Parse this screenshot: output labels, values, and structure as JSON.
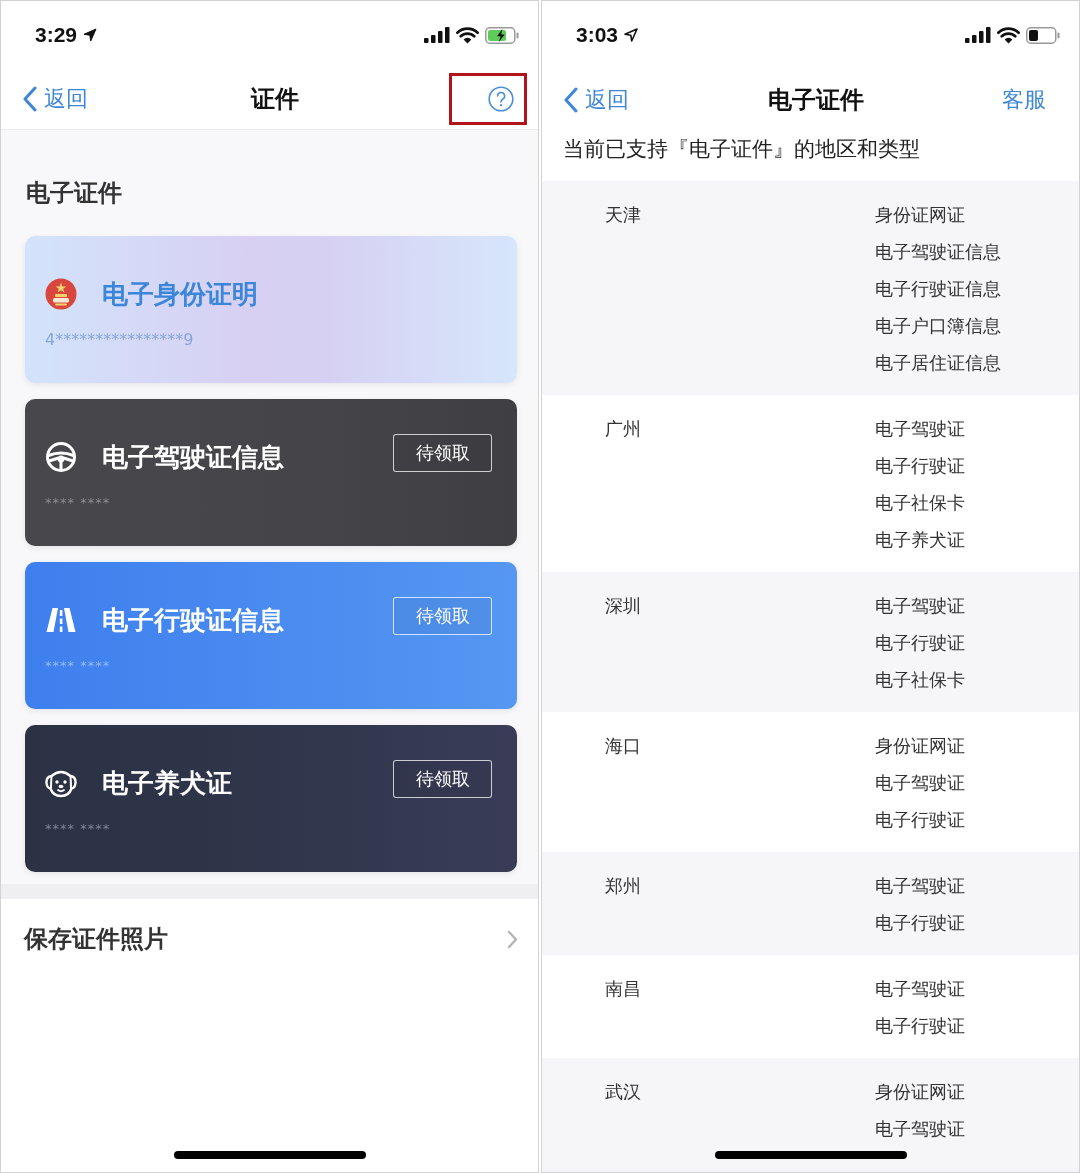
{
  "certificates_screen": {
    "status_bar": {
      "time": "3:29",
      "location_active": true,
      "charging": true
    },
    "nav": {
      "back": "返回",
      "title": "证件",
      "help_highlighted": true
    },
    "section_title": "电子证件",
    "cards": [
      {
        "kind": "id",
        "title": "电子身份证明",
        "number": "4****************9"
      },
      {
        "kind": "driver",
        "title": "电子驾驶证信息",
        "number": "**** ****",
        "action": "待领取"
      },
      {
        "kind": "vehicle",
        "title": "电子行驶证信息",
        "number": "**** ****",
        "action": "待领取"
      },
      {
        "kind": "pet",
        "title": "电子养犬证",
        "number": "**** ****",
        "action": "待领取"
      }
    ],
    "menu": [
      {
        "label": "保存证件照片"
      }
    ]
  },
  "regions_screen": {
    "status_bar": {
      "time": "3:03",
      "location_active": false,
      "charging": false
    },
    "nav": {
      "back": "返回",
      "title": "电子证件",
      "action": "客服"
    },
    "subtitle": "当前已支持『电子证件』的地区和类型",
    "regions": [
      {
        "city": "天津",
        "types": [
          "身份证网证",
          "电子驾驶证信息",
          "电子行驶证信息",
          "电子户口簿信息",
          "电子居住证信息"
        ]
      },
      {
        "city": "广州",
        "types": [
          "电子驾驶证",
          "电子行驶证",
          "电子社保卡",
          "电子养犬证"
        ]
      },
      {
        "city": "深圳",
        "types": [
          "电子驾驶证",
          "电子行驶证",
          "电子社保卡"
        ]
      },
      {
        "city": "海口",
        "types": [
          "身份证网证",
          "电子驾驶证",
          "电子行驶证"
        ]
      },
      {
        "city": "郑州",
        "types": [
          "电子驾驶证",
          "电子行驶证"
        ]
      },
      {
        "city": "南昌",
        "types": [
          "电子驾驶证",
          "电子行驶证"
        ]
      },
      {
        "city": "武汉",
        "types": [
          "身份证网证",
          "电子驾驶证"
        ]
      }
    ]
  }
}
